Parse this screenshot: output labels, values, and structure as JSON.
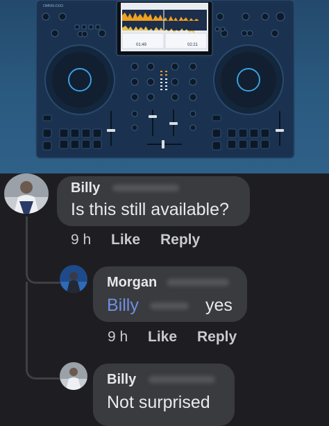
{
  "device": {
    "brand_label": "OMNIS-DUO",
    "screen_left_time": "01:49",
    "screen_right_time": "02:21"
  },
  "comments": [
    {
      "author": "Billy",
      "text": "Is this still available?",
      "time": "9 h",
      "like_label": "Like",
      "reply_label": "Reply"
    },
    {
      "author": "Morgan",
      "mention": "Billy",
      "text": "yes",
      "time": "9 h",
      "like_label": "Like",
      "reply_label": "Reply"
    },
    {
      "author": "Billy",
      "text": "Not surprised"
    }
  ],
  "colors": {
    "background": "#1e1e22",
    "bubble": "#3a3b3e",
    "mention": "#6f8fe6",
    "device_body": "#1b3350",
    "jog_ring": "#3aa0e0"
  }
}
